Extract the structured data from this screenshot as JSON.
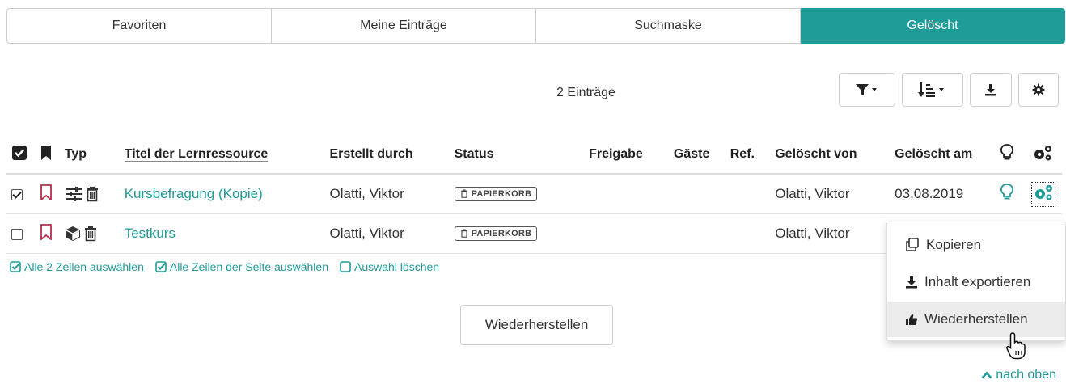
{
  "tabs": [
    {
      "label": "Favoriten"
    },
    {
      "label": "Meine Einträge"
    },
    {
      "label": "Suchmaske"
    },
    {
      "label": "Gelöscht"
    }
  ],
  "count_label": "2 Einträge",
  "columns": {
    "typ": "Typ",
    "title": "Titel der Lernressource",
    "author": "Erstellt durch",
    "status": "Status",
    "share": "Freigabe",
    "guests": "Gäste",
    "ref": "Ref.",
    "deleted_by": "Gelöscht von",
    "deleted_at": "Gelöscht am"
  },
  "rows": [
    {
      "checked": true,
      "title": "Kursbefragung (Kopie)",
      "author": "Olatti, Viktor",
      "status": "PAPIERKORB",
      "deleted_by": "Olatti, Viktor",
      "deleted_at": "03.08.2019"
    },
    {
      "checked": false,
      "title": "Testkurs",
      "author": "Olatti, Viktor",
      "status": "PAPIERKORB",
      "deleted_by": "Olatti, Viktor",
      "deleted_at": ""
    }
  ],
  "selection": {
    "select_all": "Alle 2 Zeilen auswählen",
    "select_page": "Alle Zeilen der Seite auswählen",
    "clear": "Auswahl löschen"
  },
  "restore_button": "Wiederherstellen",
  "menu": {
    "copy": "Kopieren",
    "export": "Inhalt exportieren",
    "restore": "Wiederherstellen"
  },
  "back_to_top": "nach oben",
  "colors": {
    "accent": "#1f9b98",
    "bookmark": "#b0304b"
  }
}
